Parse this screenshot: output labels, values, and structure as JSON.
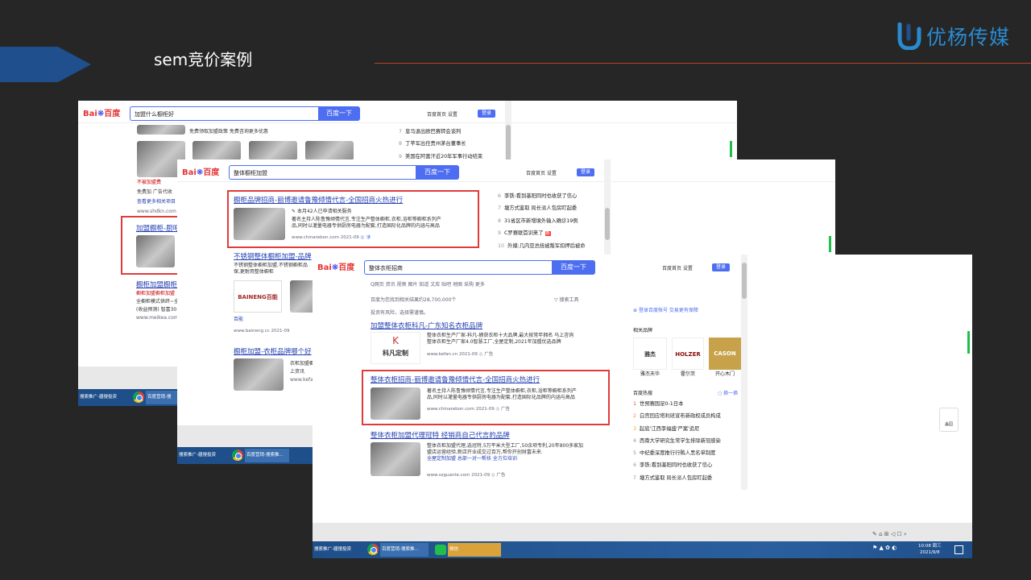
{
  "slide": {
    "title": "sem竞价案例",
    "brand_name": "优杨传媒",
    "accent_color": "#1f4f8c",
    "line_color": "#b8451f"
  },
  "window1": {
    "logo": {
      "bai": "Bai",
      "du": "百度"
    },
    "search_value": "加盟什么橱柜好",
    "search_button": "百度一下",
    "top_links": "百度首页   设置",
    "login": "登录",
    "snippet1": "免费领取加盟政策  免费咨询更多优惠",
    "side_list": [
      {
        "n": "7",
        "text": "皇马退出欧巴赛转会谈判"
      },
      {
        "n": "8",
        "text": "丁苹军出任贵州茅台董事长"
      },
      {
        "n": "9",
        "text": "美国在阿富汗近20年军事行动结束"
      }
    ],
    "left_snippets": [
      "不被加盟费",
      "免费加 广告代收",
      "查看更多相关项目",
      "www.shdkn.com 2"
    ],
    "result_title": "加盟橱柜-厨吧",
    "result2_title": "橱柜加盟橱柜",
    "result2_lines": [
      "橱柜加盟橱柜加盟",
      "全橱柜模式供终~全",
      "(收益预测) 智富30",
      "www.meikea.com"
    ],
    "taskbar": [
      "搜索推广-疆搜投资",
      "百度营销-搜"
    ]
  },
  "window2": {
    "logo": {
      "bai": "Bai",
      "du": "百度"
    },
    "search_value": "整体橱柜加盟",
    "search_button": "百度一下",
    "top_links": "百度首页   设置",
    "login": "登录",
    "result_title": "橱柜品牌招商-丽博邀请鲁豫倾情代言-全国招商火热进行",
    "badge": "本月42人已申请相关服务",
    "result_text_1": "著名主持人陈鲁豫倾情代言,专注生产整体橱柜,衣柜,浴柜等橱柜系列产",
    "result_text_2": "品,同时以灌量电器专供厨房电器为配套,打造国际化品牌的内涵与高品",
    "result_url": "www.chinarebon.com 2021-09",
    "side_list": [
      {
        "n": "6",
        "text": "李铁:看到基阳同时也收获了信心"
      },
      {
        "n": "7",
        "text": "塘方式鉴取 局长派人包房盯起委"
      },
      {
        "n": "8",
        "text": "31省区市新增境外输入确诊19例"
      },
      {
        "n": "9",
        "text": "C罗赛联首训来了"
      },
      {
        "n": "10",
        "text": "外媒:几内亚总统被叛军扣押后被命"
      }
    ],
    "r2_title": "不锈钢整体橱柜加盟-品牌",
    "r2_lines": [
      "不锈钢整体橱柜加盟,不锈钢橱柜品",
      "保,更耐用整体橱柜"
    ],
    "r2_brand": "BAINENG百能",
    "r2_brand_caption": "百能",
    "r2_url": "www.baineng.cc 2021-09",
    "r3_title": "橱柜加盟-衣柜品牌哪个好",
    "r3_lines": [
      "衣柜加盟橱柜加",
      "上资讯",
      "www.kefa"
    ],
    "taskbar": [
      "搜索推广-疆搜投资",
      "百度营销-搜索推..."
    ]
  },
  "window3": {
    "logo": {
      "bai": "Bai",
      "du": "百度"
    },
    "search_value": "整体衣柜招商",
    "search_button": "百度一下",
    "top_links": "百度首页   设置",
    "login": "登录",
    "tabs": "Q网页   资讯   视频   图片   知道   文库   贴吧   地图   采购   更多",
    "result_count": "百度为您找到相关结果约28,700,000个",
    "search_tools": "搜索工具",
    "risk_note": "投资有风险，选择需谨慎。",
    "r1_title": "加盟整体衣柜科凡-广东知名衣柜品牌",
    "r1_text_1": "整体衣柜生产厂家-科凡-摘获衣柜十大品牌,最大按常年拥名 马上咨询",
    "r1_text_2": "整体衣柜生产厂家4.0智慧工厂,全屋定制,2021年加盟优选品牌",
    "r1_url": "www.kefan.cn 2021-09",
    "r1_brand": "科凡定制",
    "r2_title": "整体衣柜招商-丽博邀请鲁豫倾情代言-全国招商火热进行",
    "r2_text_1": "著名主持人陈鲁豫倾情代言,专注生产整体橱柜,衣柜,浴柜等橱柜系列产",
    "r2_text_2": "品,同时以灌量电器专供厨房电器为配套,打造国际化品牌的内涵与高品",
    "r2_url": "www.chinarebon.com 2021-09",
    "r3_title": "整体衣柜加盟代理冠特 经销商自己代言的品牌",
    "r3_text_1": "整体衣柜加盟代理,选冠特,5万平米大型工厂,50余项专利,20年800多家加",
    "r3_text_2": "盟店运营经验,新店开业成交过百万,帮你开创财富未来.",
    "r3_links": "全屋定制加盟   总部一对一帮扶   全方位培训",
    "r3_url": "www.szguante.com 2021-09",
    "ad": "广告",
    "side_login": "登录百度帐号 交易更有保障",
    "side_brand_heading": "相关品牌",
    "brands": [
      "雅杰天华",
      "霍尔茨",
      "开心木门"
    ],
    "hot_heading": "百度热搜",
    "hot_refresh": "换一换",
    "hot_list": [
      {
        "n": "1",
        "text": "世预赛国足0-1日本"
      },
      {
        "n": "2",
        "text": "白宫回应塔利班宣布新政权成员构成"
      },
      {
        "n": "3",
        "text": "起底'江西李福盛'严案'追尼"
      },
      {
        "n": "4",
        "text": "西南大学研究生常学生排除新冠感染"
      },
      {
        "n": "5",
        "text": "中纪委深度推行行贿人黑名单制度"
      },
      {
        "n": "6",
        "text": "李铁:看到基阳同时也收获了信心"
      },
      {
        "n": "7",
        "text": "塘方式鉴取 局长派人包房盯起委"
      }
    ],
    "float_label": "盖园",
    "taskbar": [
      "搜索推广-疆搜投资",
      "百度营销-搜索推...",
      "微信"
    ],
    "clock_time": "10:08 周三",
    "clock_date": "2021/9/8"
  }
}
